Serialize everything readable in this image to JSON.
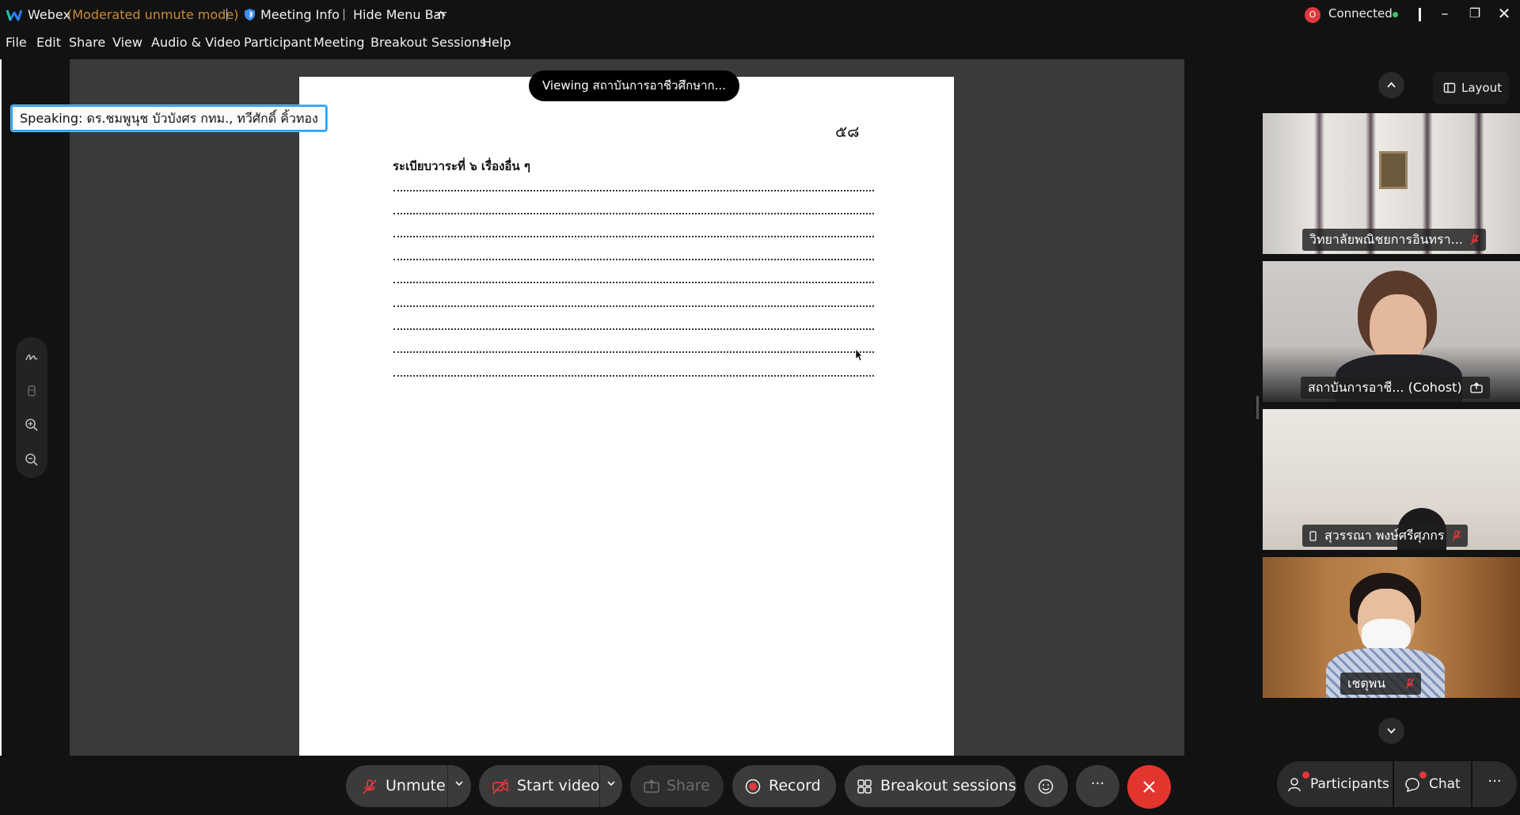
{
  "titlebar": {
    "app_name": "Webex",
    "mode": "(Moderated unmute mode)",
    "meeting_info": "Meeting Info",
    "hide_menu_bar": "Hide Menu Bar",
    "record_badge": "O",
    "connection_status": "Connected"
  },
  "menu": [
    "File",
    "Edit",
    "Share",
    "View",
    "Audio & Video",
    "Participant",
    "Meeting",
    "Breakout Sessions",
    "Help"
  ],
  "stage": {
    "viewing": "Viewing สถาบันการอาชีวศึกษาก...",
    "speaking": "Speaking: ดร.ชมพูนุช บัวบังศร กทม., ทวีศักดิ์ คิ้วทอง"
  },
  "document": {
    "page_number": "๕๘",
    "agenda_title": "ระเบียบวาระที่ ๖  เรื่องอื่น ๆ",
    "blank_lines": 9
  },
  "right_panel": {
    "layout_label": "Layout",
    "participants": [
      {
        "name": "วิทยาลัยพณิชยการอินทรา...",
        "muted": true
      },
      {
        "name": "สถาบันการอาชี... (Cohost)",
        "muted": false,
        "sharing": true
      },
      {
        "name": "สุวรรณา พงษ์ศรีศุภกร",
        "muted": true,
        "mobile": true
      },
      {
        "name": "เชตุพน",
        "muted": true
      }
    ]
  },
  "controls": {
    "unmute": "Unmute",
    "start_video": "Start video",
    "share": "Share",
    "record": "Record",
    "breakout": "Breakout sessions",
    "participants": "Participants",
    "chat": "Chat",
    "more": "···"
  },
  "colors": {
    "mute_red": "#e0383b",
    "end_red": "#e3352e",
    "connected_green": "#3cc26a",
    "speaking_border": "#2aa2f5",
    "mode_orange": "#c98a3a"
  }
}
